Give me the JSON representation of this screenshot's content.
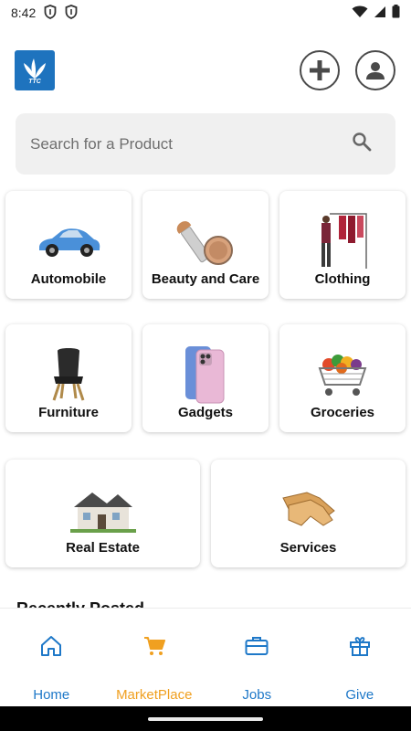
{
  "status_bar": {
    "time": "8:42"
  },
  "header": {
    "logo_text": "TTC"
  },
  "search": {
    "placeholder": "Search for a Product"
  },
  "categories": [
    {
      "label": "Automobile"
    },
    {
      "label": "Beauty and Care"
    },
    {
      "label": "Clothing"
    },
    {
      "label": "Furniture"
    },
    {
      "label": "Gadgets"
    },
    {
      "label": "Groceries"
    },
    {
      "label": "Real Estate"
    },
    {
      "label": "Services"
    }
  ],
  "recent_section": {
    "title": "Recently Posted"
  },
  "bottom_nav": {
    "items": [
      {
        "label": "Home",
        "icon": "home-icon"
      },
      {
        "label": "MarketPlace",
        "icon": "cart-icon",
        "active": true
      },
      {
        "label": "Jobs",
        "icon": "briefcase-icon"
      },
      {
        "label": "Give",
        "icon": "gift-icon"
      }
    ]
  },
  "colors": {
    "brand_blue": "#1e73be",
    "nav_blue": "#1e78c8",
    "active_orange": "#f0a020"
  }
}
